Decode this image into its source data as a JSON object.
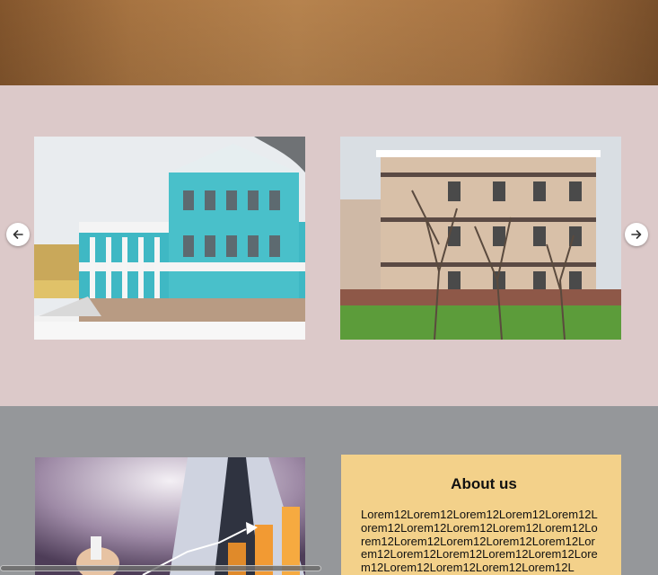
{
  "colors": {
    "hero": "#b07a45",
    "gallery_bg": "#dcc9c9",
    "about_bg": "#95979a",
    "about_card": "#f3d18a"
  },
  "gallery": {
    "prev_icon": "arrow-left-icon",
    "next_icon": "arrow-right-icon"
  },
  "about": {
    "title": "About us",
    "text": "Lorem12Lorem12Lorem12Lorem12Lorem12Lorem12Lorem12Lorem12Lorem12Lorem12Lorem12Lorem12Lorem12Lorem12Lorem12Lorem12Lorem12Lorem12Lorem12Lorem12Lorem12Lorem12Lorem12Lorem12Lorem12L"
  }
}
